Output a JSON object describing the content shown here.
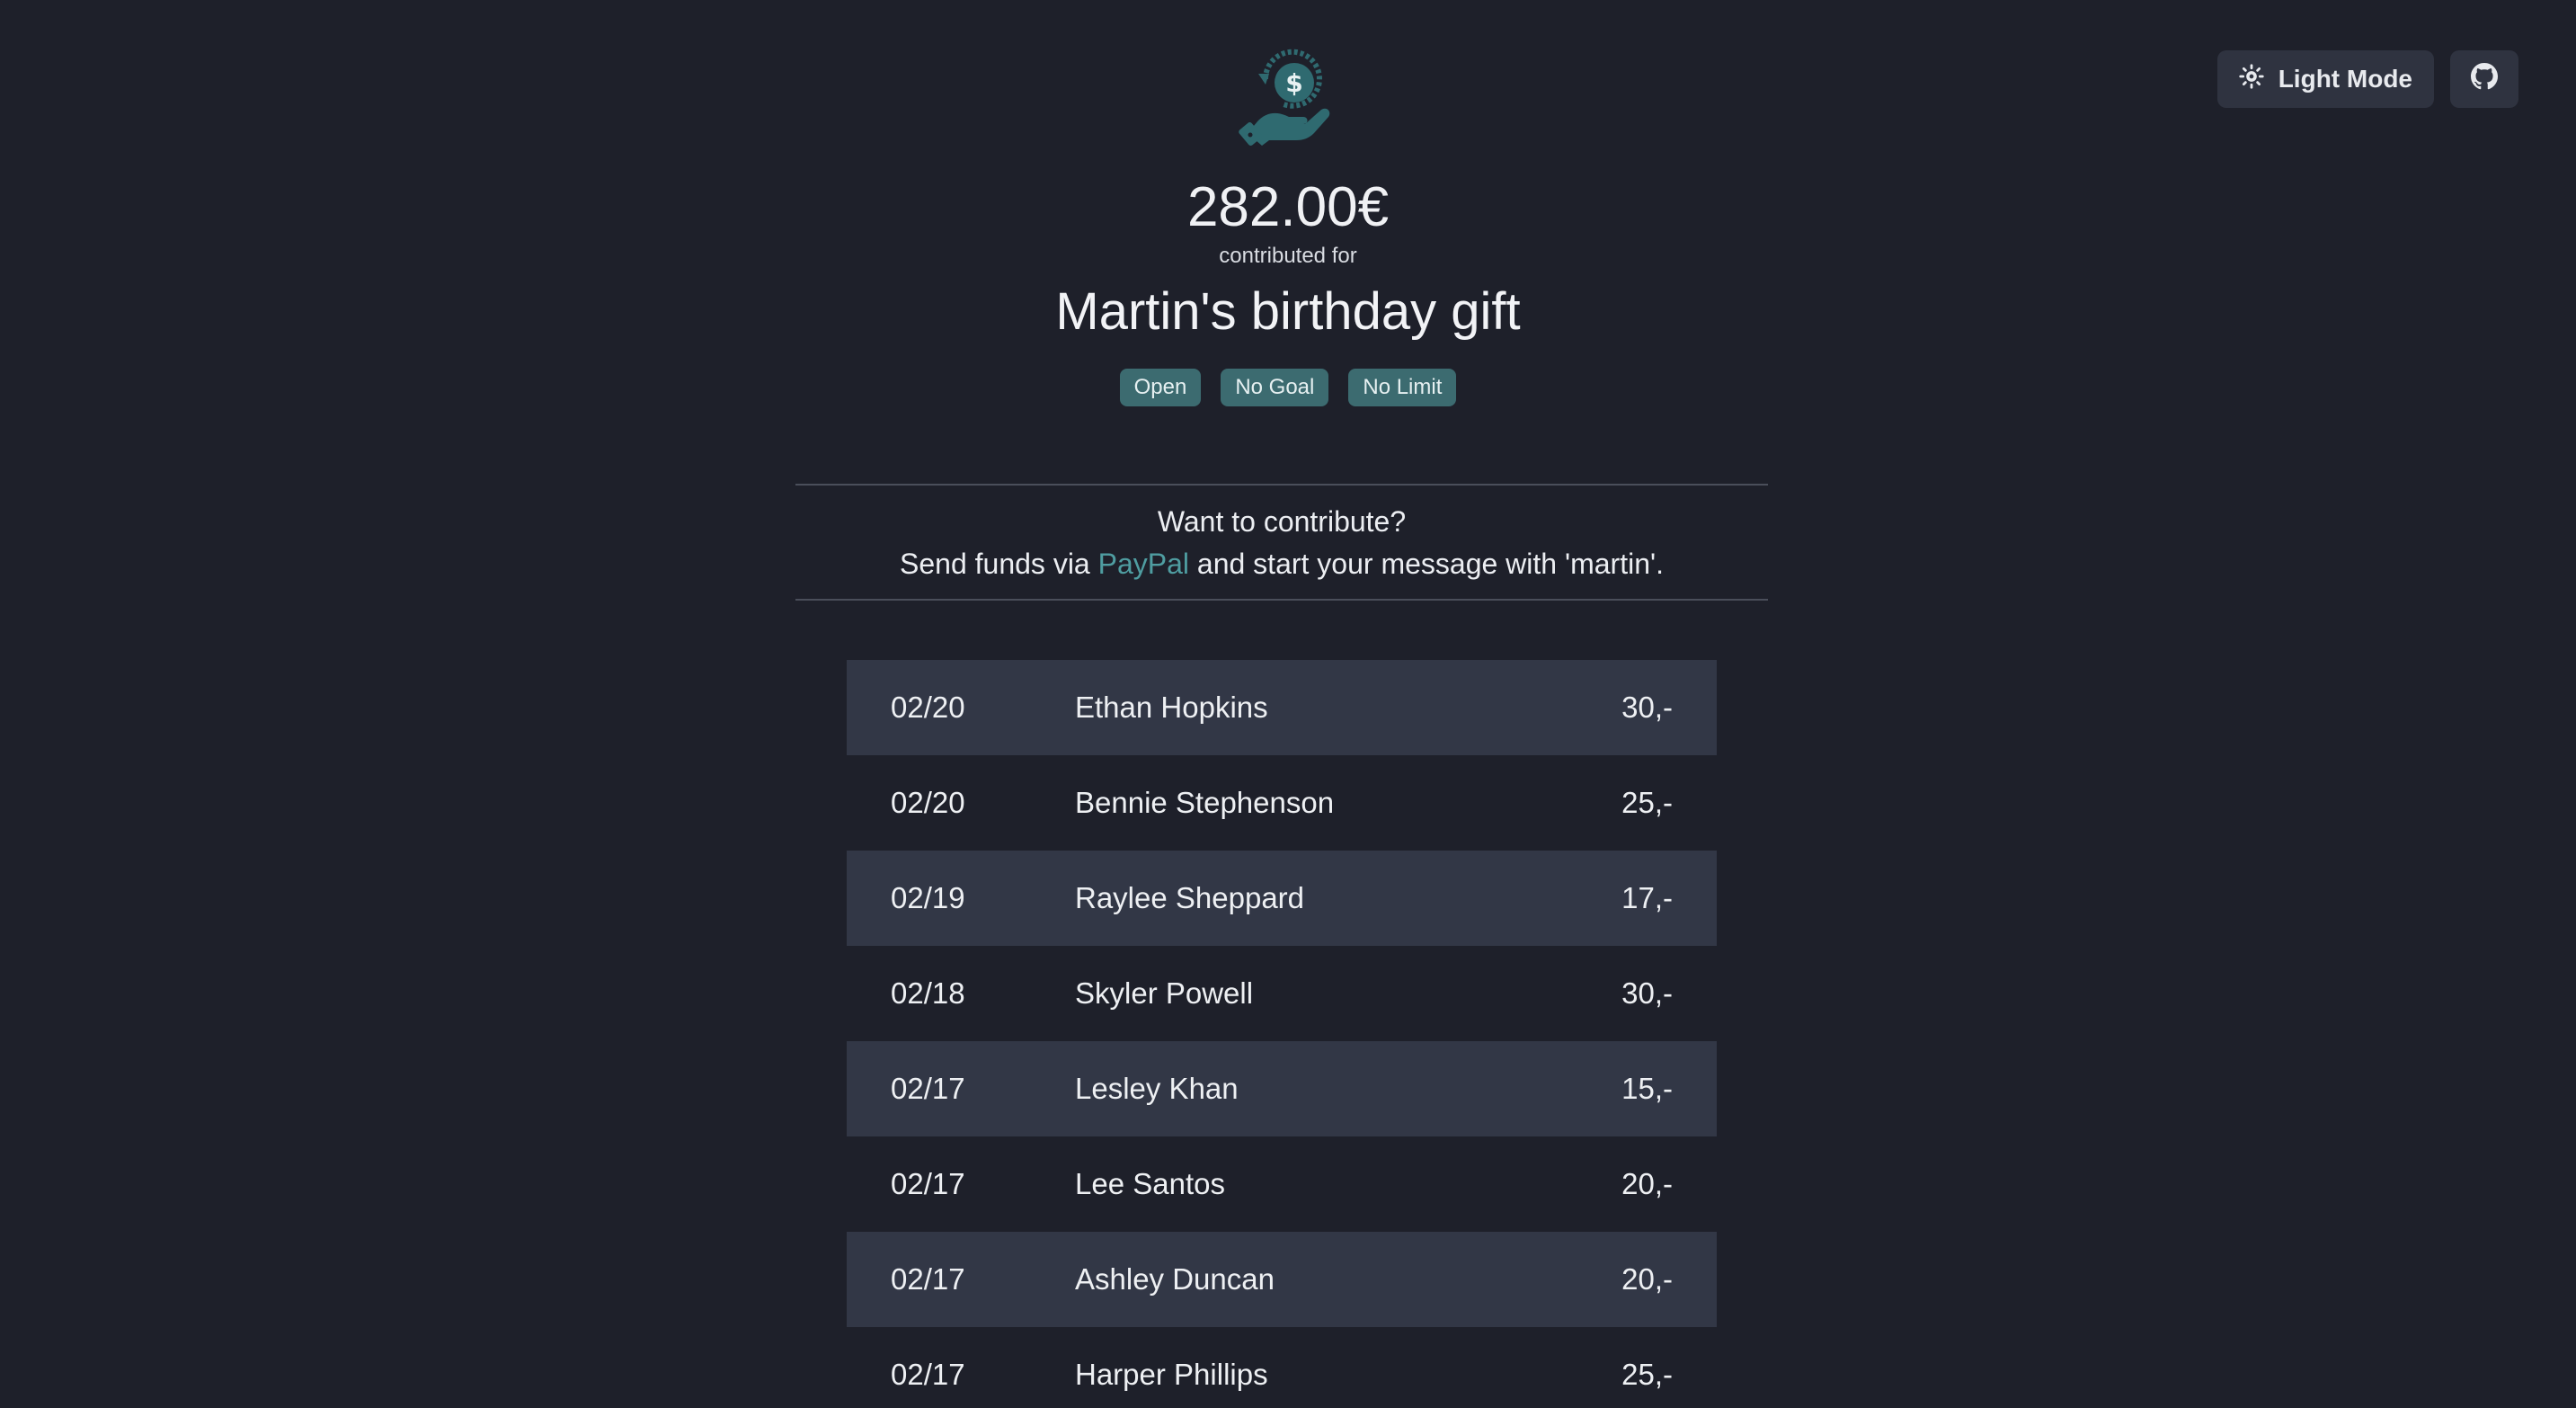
{
  "controls": {
    "theme_label": "Light Mode"
  },
  "header": {
    "amount": "282.00€",
    "caption": "contributed for",
    "title": "Martin's birthday gift",
    "badges": [
      "Open",
      "No Goal",
      "No Limit"
    ]
  },
  "contribute": {
    "question": "Want to contribute?",
    "prefix": "Send funds via ",
    "link_text": "PayPal",
    "suffix": " and start your message with 'martin'."
  },
  "colors": {
    "background": "#1e202a",
    "accent": "#3c6b70",
    "link": "#4f9da1",
    "row_alt": "#323746"
  },
  "icons": [
    "sun-icon",
    "github-icon",
    "money-hand-logo-icon"
  ],
  "contributions": [
    {
      "date": "02/20",
      "name": "Ethan Hopkins",
      "amount": "30,-"
    },
    {
      "date": "02/20",
      "name": "Bennie Stephenson",
      "amount": "25,-"
    },
    {
      "date": "02/19",
      "name": "Raylee Sheppard",
      "amount": "17,-"
    },
    {
      "date": "02/18",
      "name": "Skyler Powell",
      "amount": "30,-"
    },
    {
      "date": "02/17",
      "name": "Lesley Khan",
      "amount": "15,-"
    },
    {
      "date": "02/17",
      "name": "Lee Santos",
      "amount": "20,-"
    },
    {
      "date": "02/17",
      "name": "Ashley Duncan",
      "amount": "20,-"
    },
    {
      "date": "02/17",
      "name": "Harper Phillips",
      "amount": "25,-"
    }
  ]
}
